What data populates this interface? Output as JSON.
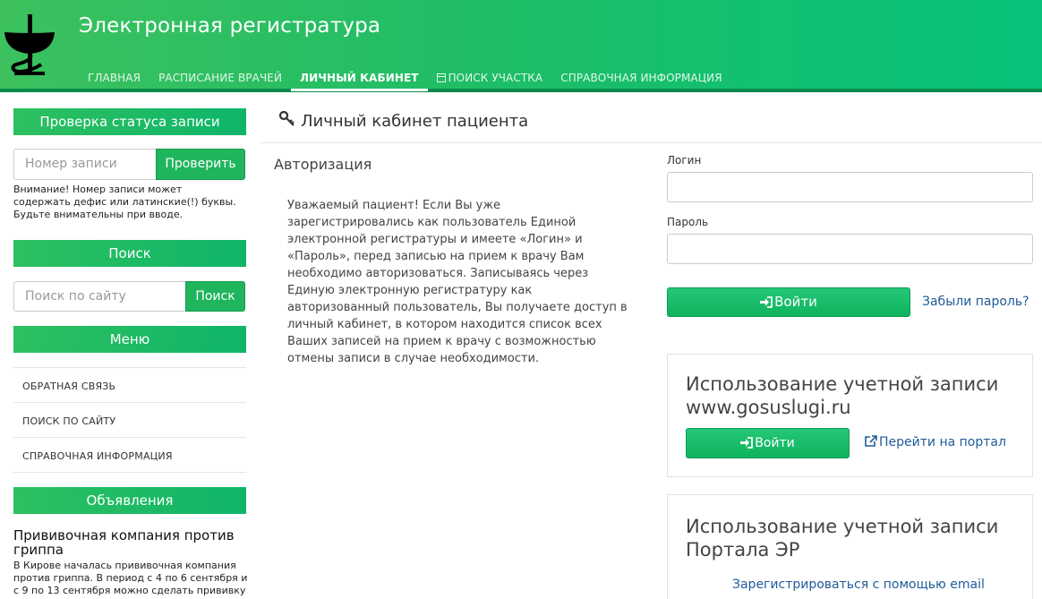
{
  "header": {
    "site_title": "Электронная регистратура",
    "nav": [
      {
        "label": "ГЛАВНАЯ"
      },
      {
        "label": "РАСПИСАНИЕ ВРАЧЕЙ"
      },
      {
        "label": "ЛИЧНЫЙ КАБИНЕТ",
        "active": true
      },
      {
        "label": "ПОИСК УЧАСТКА",
        "icon": "calendar-icon"
      },
      {
        "label": "СПРАВОЧНАЯ ИНФОРМАЦИЯ"
      }
    ]
  },
  "sidebar": {
    "status_check": {
      "title": "Проверка статуса записи",
      "input_placeholder": "Номер записи",
      "button": "Проверить",
      "note": "Внимание! Номер записи может содержать дефис или латинские(!) буквы. Будьте внимательны при вводе."
    },
    "search": {
      "title": "Поиск",
      "input_placeholder": "Поиск по сайту",
      "button": "Поиск"
    },
    "menu": {
      "title": "Меню",
      "items": [
        "ОБРАТНАЯ СВЯЗЬ",
        "ПОИСК ПО САЙТУ",
        "СПРАВОЧНАЯ ИНФОРМАЦИЯ"
      ]
    },
    "announcements": {
      "title": "Объявления",
      "news_title": "Прививочная компания против гриппа",
      "news_text": "В Кирове началась прививочная компания против гриппа. В период с 4 по 6 сентября и с 9 по 13 сентября можно сделать прививку в"
    }
  },
  "main": {
    "title": "Личный кабинет пациента",
    "auth_title": "Авторизация",
    "auth_text": "Уважаемый пациент! Если Вы уже зарегистрировались как пользователь Единой электронной регистратуры и имеете «Логин» и «Пароль», перед записью на прием к врачу Вам необходимо авторизоваться. Записываясь через Единую электронную регистратуру как авторизованный пользователь, Вы получаете доступ в личный кабинет, в котором находится список всех Ваших записей на прием к врачу с возможностью отмены записи в случае необходимости.",
    "login_label": "Логин",
    "password_label": "Пароль",
    "login_button": "Войти",
    "forgot_link": "Забыли пароль?",
    "gosuslugi": {
      "title": "Использование учетной записи www.gosuslugi.ru",
      "button": "Войти",
      "portal_link": "Перейти на портал"
    },
    "portal_er": {
      "title": "Использование учетной записи Портала ЭР",
      "register_link": "Зарегистрироваться с помощью email"
    }
  },
  "colors": {
    "brand_green": "#1fb55d",
    "link_blue": "#1f5b9a"
  }
}
